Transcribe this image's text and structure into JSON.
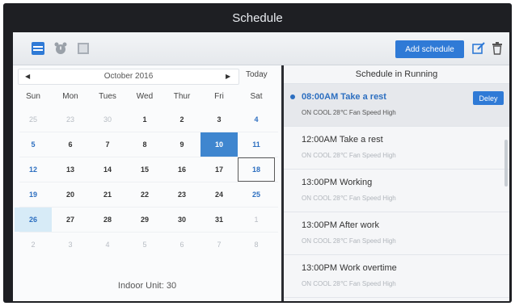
{
  "window": {
    "title": "Schedule"
  },
  "toolbar": {
    "add_label": "Add schedule"
  },
  "calendar": {
    "month_label": "October 2016",
    "today_label": "Today",
    "weekdays": [
      "Sun",
      "Mon",
      "Tues",
      "Wed",
      "Thur",
      "Fri",
      "Sat"
    ],
    "weeks": [
      [
        "25",
        "23",
        "30",
        "1",
        "2",
        "3",
        "4"
      ],
      [
        "5",
        "6",
        "7",
        "8",
        "9",
        "10",
        "11"
      ],
      [
        "12",
        "13",
        "14",
        "15",
        "16",
        "17",
        "18"
      ],
      [
        "19",
        "20",
        "21",
        "22",
        "23",
        "24",
        "25"
      ],
      [
        "26",
        "27",
        "28",
        "29",
        "30",
        "31",
        "1"
      ],
      [
        "2",
        "3",
        "4",
        "5",
        "6",
        "7",
        "8"
      ]
    ],
    "indoor_label": "Indoor Unit: 30"
  },
  "schedule": {
    "title": "Schedule in Running",
    "delete_label": "Deley",
    "items": [
      {
        "title": "08:00AM Take a rest",
        "sub": "ON   COOL 28℃   Fan Speed High",
        "active": true
      },
      {
        "title": "12:00AM Take a rest",
        "sub": "ON   COOL 28℃   Fan Speed High",
        "active": false
      },
      {
        "title": "13:00PM Working",
        "sub": "ON   COOL 28℃   Fan Speed High",
        "active": false
      },
      {
        "title": "13:00PM After work",
        "sub": "ON   COOL 28℃   Fan Speed High",
        "active": false
      },
      {
        "title": "13:00PM Work overtime",
        "sub": "ON   COOL 28℃   Fan Speed High",
        "active": false
      }
    ]
  }
}
